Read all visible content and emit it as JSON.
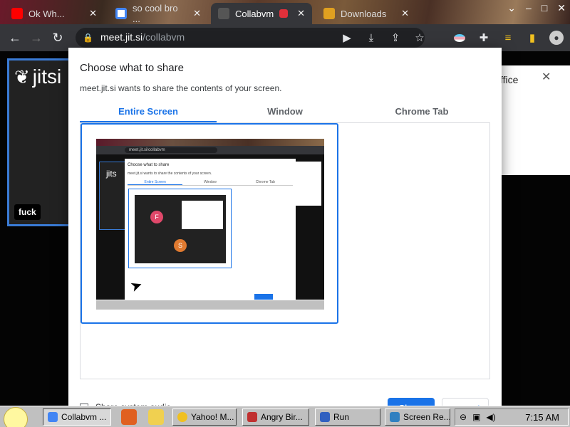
{
  "browser": {
    "tabs": [
      {
        "title": "Ok Wh...",
        "color": "#ff0000"
      },
      {
        "title": "so cool bro ...",
        "color": "#4285f4"
      },
      {
        "title": "Collabvm",
        "color": "#555555",
        "active": true
      },
      {
        "title": "Downloads",
        "color": "#e0a020"
      }
    ],
    "url_host": "meet.jit.si",
    "url_path": "/collabvm"
  },
  "page": {
    "logo": "jitsi",
    "participant_label": "fuck",
    "notice_text": "ffice"
  },
  "dialog": {
    "title": "Choose what to share",
    "subtitle": "meet.jit.si wants to share the contents of your screen.",
    "tabs": [
      "Entire Screen",
      "Window",
      "Chrome Tab"
    ],
    "active_tab": "Entire Screen",
    "audio_label": "Share system audio",
    "share_label": "Share",
    "cancel_label": "Cancel",
    "thumb": {
      "url": "meet.jit.si/collabvm",
      "title": "Choose what to share",
      "subtitle": "meet.jit.si wants to share the contents of your screen.",
      "tabs": [
        "Entire Screen",
        "Window",
        "Chrome Tab"
      ],
      "avatar_f": "F",
      "avatar_s": "S",
      "fuck": "fuck"
    }
  },
  "taskbar": {
    "items": [
      {
        "label": "Collabvm ...",
        "color": "#4285f4",
        "pressed": true
      },
      {
        "label": "Yahoo! M...",
        "color": "#f0c020"
      },
      {
        "label": "Angry Bir...",
        "color": "#c03030"
      },
      {
        "label": "Run",
        "color": "#3060c0"
      },
      {
        "label": "Screen Re...",
        "color": "#3080c0"
      }
    ],
    "clock": "7:15 AM"
  },
  "icons": [
    "youtube-icon",
    "google-icon",
    "collabvm-icon",
    "downloads-icon",
    "lock-icon",
    "back-icon",
    "forward-icon",
    "reload-icon",
    "camera-icon",
    "install-icon",
    "share-icon",
    "star-icon",
    "extension-icon",
    "profile-icon",
    "menu-icon",
    "jitsi-icon",
    "close-icon"
  ]
}
